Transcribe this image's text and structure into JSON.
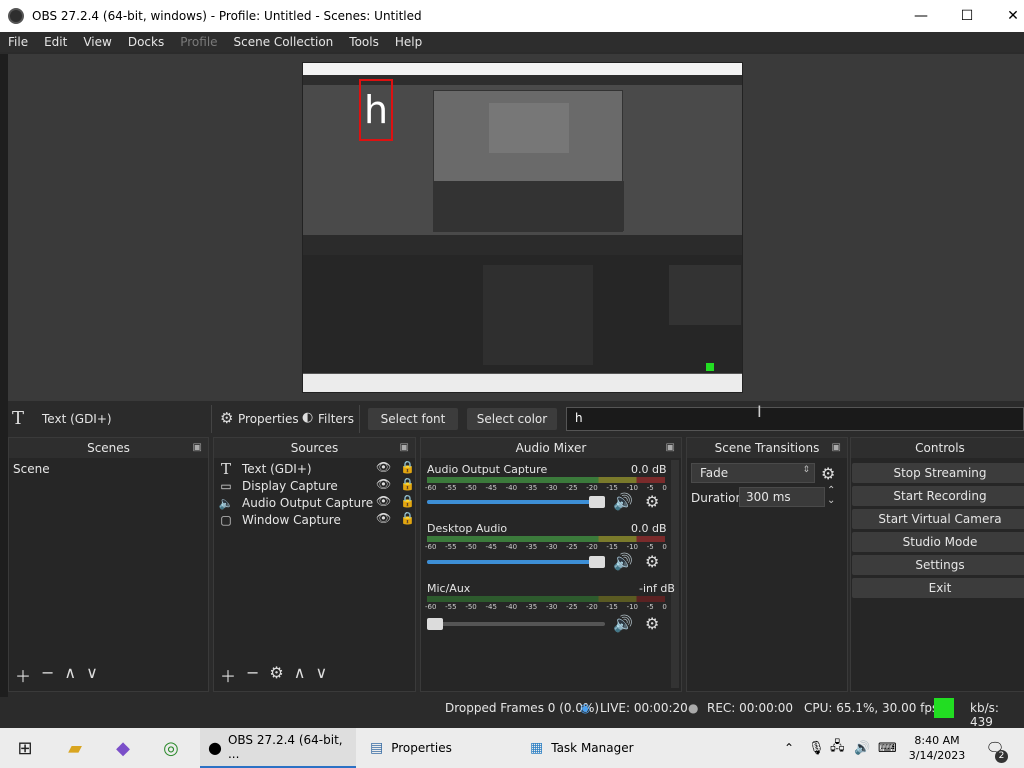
{
  "window": {
    "title": "OBS 27.2.4 (64-bit, windows) - Profile: Untitled - Scenes: Untitled",
    "minimize_glyph": "—",
    "maximize_glyph": "☐",
    "close_glyph": "✕"
  },
  "menu": [
    "File",
    "Edit",
    "View",
    "Docks",
    "Profile",
    "Scene Collection",
    "Tools",
    "Help"
  ],
  "source_toolbar": {
    "icon": "text-icon",
    "selected_source": "Text (GDI+)",
    "properties": "Properties",
    "filters": "Filters",
    "select_font": "Select font",
    "select_color": "Select color",
    "text_value": "h"
  },
  "scenes": {
    "title": "Scenes",
    "items": [
      "Scene"
    ]
  },
  "sources": {
    "title": "Sources",
    "items": [
      {
        "label": "Text (GDI+)",
        "icon": "text-icon"
      },
      {
        "label": "Display Capture",
        "icon": "monitor-icon"
      },
      {
        "label": "Audio Output Capture",
        "icon": "speaker-icon"
      },
      {
        "label": "Window Capture",
        "icon": "window-icon"
      }
    ]
  },
  "mixer": {
    "title": "Audio Mixer",
    "ticks": [
      "-60",
      "-55",
      "-50",
      "-45",
      "-40",
      "-35",
      "-30",
      "-25",
      "-20",
      "-15",
      "-10",
      "-5",
      "0"
    ],
    "channels": [
      {
        "name": "Audio Output Capture",
        "level": "0.0 dB",
        "volume": 1.0
      },
      {
        "name": "Desktop Audio",
        "level": "0.0 dB",
        "volume": 1.0
      },
      {
        "name": "Mic/Aux",
        "level": "-inf dB",
        "volume": 0.0
      }
    ]
  },
  "transitions": {
    "title": "Scene Transitions",
    "selected": "Fade",
    "duration_label": "Duration",
    "duration_value": "300 ms"
  },
  "controls": {
    "title": "Controls",
    "buttons": [
      "Stop Streaming",
      "Start Recording",
      "Start Virtual Camera",
      "Studio Mode",
      "Settings",
      "Exit"
    ]
  },
  "status": {
    "dropped": "Dropped Frames 0 (0.0%)",
    "live": "LIVE: 00:00:20",
    "rec": "REC: 00:00:00",
    "cpu": "CPU: 65.1%, 30.00 fps",
    "kbs": "kb/s: 439",
    "stream_color": "#22dd22"
  },
  "preview_text": "h",
  "taskbar": {
    "items": [
      {
        "label": "OBS 27.2.4 (64-bit, ...",
        "active": true
      },
      {
        "label": "Properties",
        "active": false
      },
      {
        "label": "Task Manager",
        "active": false
      }
    ],
    "time": "8:40 AM",
    "date": "3/14/2023",
    "notifications": "2"
  }
}
